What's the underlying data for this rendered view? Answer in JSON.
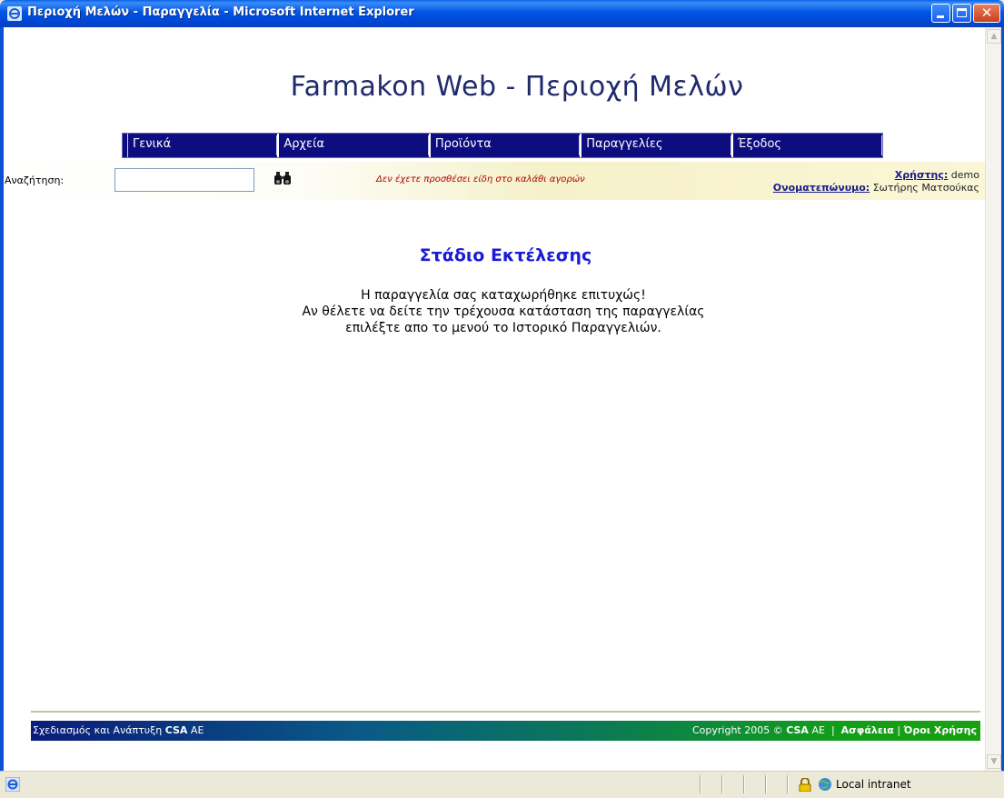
{
  "window": {
    "title": "Περιοχή Μελών - Παραγγελία - Microsoft Internet Explorer"
  },
  "page": {
    "site_title": "Farmakon Web - Περιοχή Μελών",
    "menu": [
      {
        "label": "Γενικά"
      },
      {
        "label": "Αρχεία"
      },
      {
        "label": "Προϊόντα"
      },
      {
        "label": "Παραγγελίες"
      },
      {
        "label": "Έξοδος"
      }
    ],
    "search": {
      "label": "Αναζήτηση:",
      "value": "",
      "button_icon": "binoculars-icon"
    },
    "cart_message": "Δεν έχετε προσθέσει είδη στο καλάθι αγορών",
    "user": {
      "user_label": "Χρήστης:",
      "user_value": "demo",
      "name_label": "Ονοματεπώνυμο:",
      "name_value": "Σωτήρης Ματσούκας"
    },
    "stage": {
      "title": "Στάδιο Εκτέλεσης",
      "line1": "Η παραγγελία σας καταχωρήθηκε επιτυχώς!",
      "line2": "Αν θέλετε να δείτε την τρέχουσα κατάσταση της παραγγελίας",
      "line3": "επιλέξτε απο το μενού το Ιστορικό Παραγγελιών."
    },
    "footer": {
      "design_prefix": "Σχεδιασμός και Ανάπτυξη",
      "design_company": "CSA",
      "design_suffix": "AE",
      "copyright_prefix": "Copyright 2005 ©",
      "copyright_company": "CSA",
      "copyright_suffix": "AE",
      "separator": "|",
      "security_link": "Ασφάλεια",
      "terms_link": "Όροι Χρήσης"
    }
  },
  "statusbar": {
    "zone": "Local intranet"
  },
  "colors": {
    "menu_bg": "#0d0d80",
    "title_text": "#1f2a6b",
    "stage_title": "#1c1cd6",
    "cart_msg": "#b00000"
  }
}
